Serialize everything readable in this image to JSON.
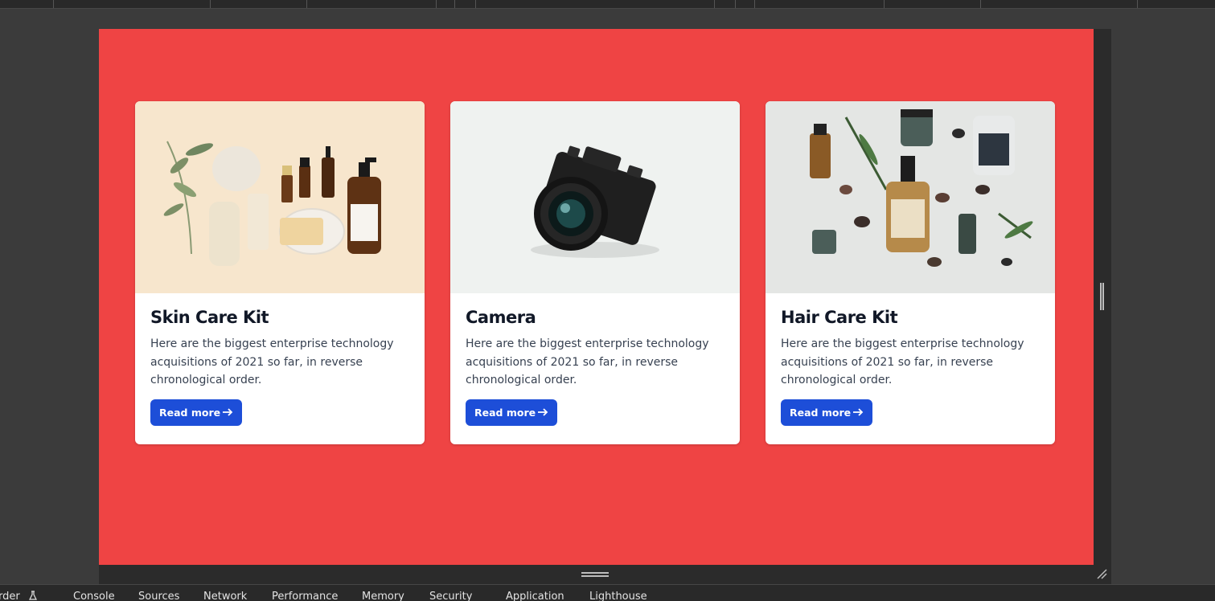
{
  "cards": [
    {
      "title": "Skin Care Kit",
      "text": "Here are the biggest enterprise technology acquisitions of 2021 so far, in reverse chronological order.",
      "button_label": "Read more",
      "image_subject": "skin care products flat lay"
    },
    {
      "title": "Camera",
      "text": "Here are the biggest enterprise technology acquisitions of 2021 so far, in reverse chronological order.",
      "button_label": "Read more",
      "image_subject": "black mirrorless camera"
    },
    {
      "title": "Hair Care Kit",
      "text": "Here are the biggest enterprise technology acquisitions of 2021 so far, in reverse chronological order.",
      "button_label": "Read more",
      "image_subject": "hair care bottles and stones"
    }
  ],
  "devtools": {
    "tabs": [
      "rder",
      "Console",
      "Sources",
      "Network",
      "Performance",
      "Memory",
      "Security",
      "Application",
      "Lighthouse"
    ]
  },
  "colors": {
    "page_background": "#ef4444",
    "button": "#1d4ed8",
    "card": "#ffffff",
    "devtools": "#292929"
  },
  "icons": {
    "button_arrow": "arrow-right-icon",
    "recorder": "flask-icon"
  }
}
